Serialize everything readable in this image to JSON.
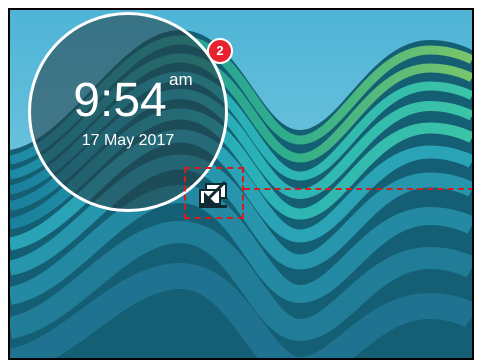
{
  "clock": {
    "time": "9:54",
    "ampm": "am",
    "date": "17 May 2017"
  },
  "notifications": {
    "count": "2"
  },
  "icons": {
    "collapse": "collapse-screen-icon"
  },
  "colors": {
    "badge": "#e8212f",
    "highlight": "#d41e1e",
    "clock_ring": "#ffffff"
  }
}
